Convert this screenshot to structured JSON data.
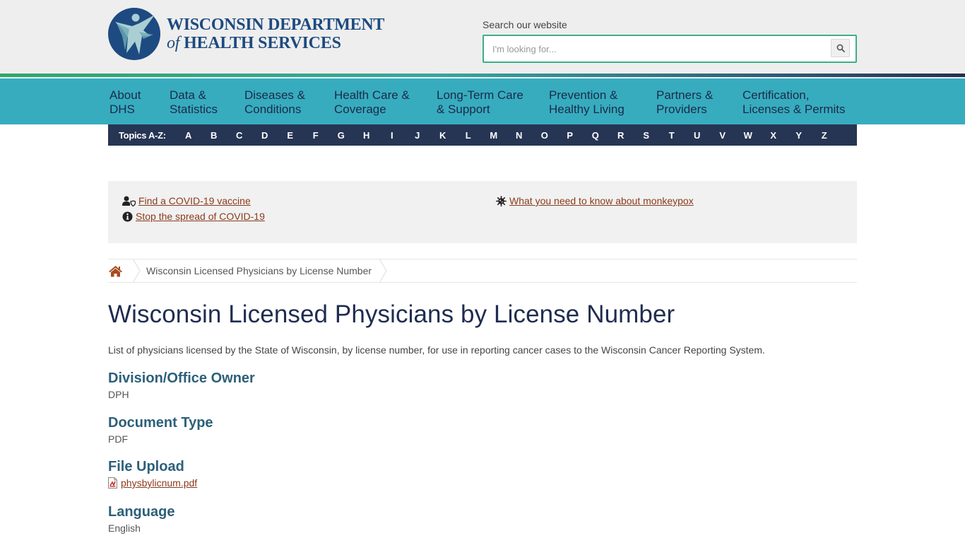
{
  "header": {
    "logo": {
      "line1": "WISCONSIN DEPARTMENT",
      "line2_of": "of",
      "line2_rest": " HEALTH SERVICES",
      "colors": {
        "brand_navy": "#1d4a80",
        "figure_light": "#a9cfd4"
      }
    },
    "search": {
      "label": "Search our website",
      "placeholder": "I'm looking for...",
      "value": "",
      "button_icon": "search-icon"
    }
  },
  "main_nav": {
    "items": [
      {
        "line1": "About",
        "line2": "DHS"
      },
      {
        "line1": "Data &",
        "line2": "Statistics"
      },
      {
        "line1": "Diseases &",
        "line2": "Conditions"
      },
      {
        "line1": "Health Care &",
        "line2": "Coverage"
      },
      {
        "line1": "Long-Term Care",
        "line2": "& Support"
      },
      {
        "line1": "Prevention &",
        "line2": "Healthy Living"
      },
      {
        "line1": "Partners &",
        "line2": "Providers"
      },
      {
        "line1": "Certification,",
        "line2": "Licenses & Permits"
      }
    ]
  },
  "topics": {
    "label": "Topics A-Z:",
    "letters": [
      "A",
      "B",
      "C",
      "D",
      "E",
      "F",
      "G",
      "H",
      "I",
      "J",
      "K",
      "L",
      "M",
      "N",
      "O",
      "P",
      "Q",
      "R",
      "S",
      "T",
      "U",
      "V",
      "W",
      "X",
      "Y",
      "Z"
    ]
  },
  "alerts": [
    {
      "icon": "user-shield-icon",
      "text": "Find a COVID-19 vaccine"
    },
    {
      "icon": "info-circle-icon",
      "text": "Stop the spread of COVID-19"
    },
    {
      "icon": "virus-icon",
      "text": "What you need to know about monkeypox"
    }
  ],
  "breadcrumb": {
    "home_icon": "home-icon",
    "current": "Wisconsin Licensed Physicians by License Number"
  },
  "page": {
    "title": "Wisconsin Licensed Physicians by License Number",
    "description": "List of physicians licensed by the State of Wisconsin, by license number, for use in reporting cancer cases to the Wisconsin Cancer Reporting System.",
    "fields": [
      {
        "label": "Division/Office Owner",
        "value": "DPH"
      },
      {
        "label": "Document Type",
        "value": "PDF"
      },
      {
        "label": "File Upload",
        "file": "physbylicnum.pdf",
        "icon": "pdf-file-icon"
      },
      {
        "label": "Language",
        "value": "English"
      }
    ]
  },
  "colors": {
    "nav_teal": "#37acbf",
    "topics_navy": "#263553",
    "link_rust": "#8a3b1c",
    "heading_teal": "#2c6079",
    "search_border": "#3fae8a"
  }
}
